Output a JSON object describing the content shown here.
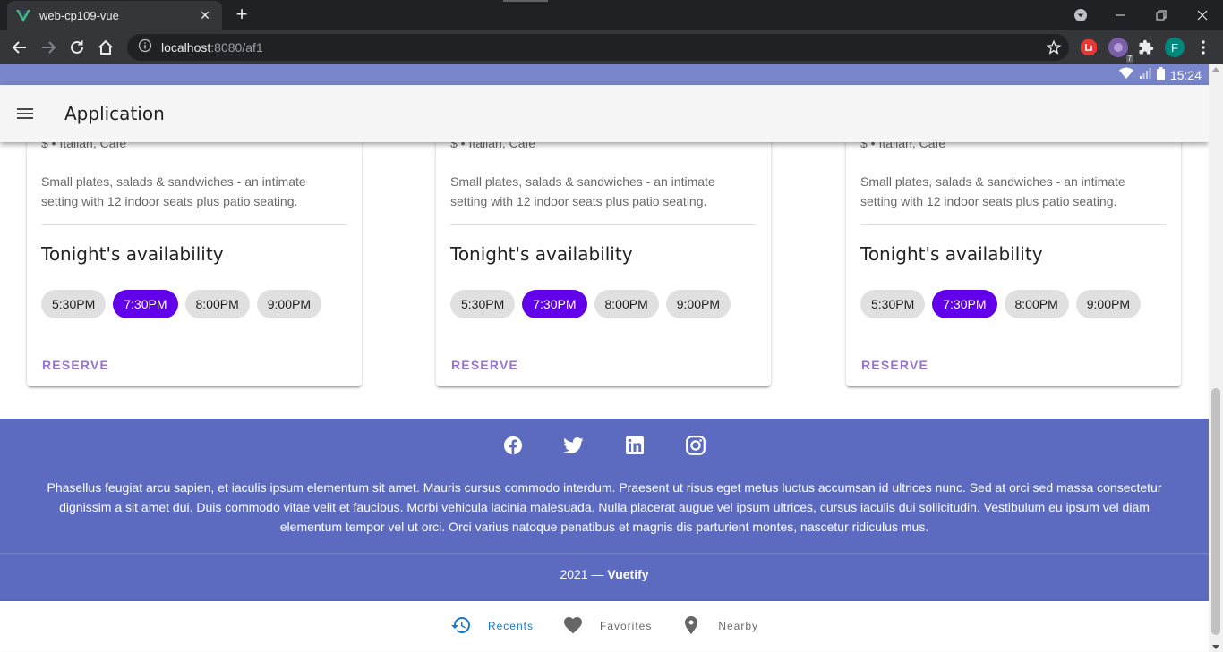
{
  "browser": {
    "tab_title": "web-cp109-vue",
    "url_host": "localhost",
    "url_rest": ":8080/af1",
    "profile_initial": "F",
    "extension_badge": "7"
  },
  "system_bar": {
    "time": "15:24"
  },
  "app_bar": {
    "title": "Application"
  },
  "cards": [
    {
      "meta": "$ • Italian, Cafe",
      "description": "Small plates, salads & sandwiches - an intimate setting with 12 indoor seats plus patio seating.",
      "heading": "Tonight's availability",
      "times": [
        "5:30PM",
        "7:30PM",
        "8:00PM",
        "9:00PM"
      ],
      "selected_time": "7:30PM",
      "action": "RESERVE"
    },
    {
      "meta": "$ • Italian, Cafe",
      "description": "Small plates, salads & sandwiches - an intimate setting with 12 indoor seats plus patio seating.",
      "heading": "Tonight's availability",
      "times": [
        "5:30PM",
        "7:30PM",
        "8:00PM",
        "9:00PM"
      ],
      "selected_time": "7:30PM",
      "action": "RESERVE"
    },
    {
      "meta": "$ • Italian, Cafe",
      "description": "Small plates, salads & sandwiches - an intimate setting with 12 indoor seats plus patio seating.",
      "heading": "Tonight's availability",
      "times": [
        "5:30PM",
        "7:30PM",
        "8:00PM",
        "9:00PM"
      ],
      "selected_time": "7:30PM",
      "action": "RESERVE"
    }
  ],
  "footer": {
    "social_icons": [
      "facebook-icon",
      "twitter-icon",
      "linkedin-icon",
      "instagram-icon"
    ],
    "text": "Phasellus feugiat arcu sapien, et iaculis ipsum elementum sit amet. Mauris cursus commodo interdum. Praesent ut risus eget metus luctus accumsan id ultrices nunc. Sed at orci sed massa consectetur dignissim a sit amet dui. Duis commodo vitae velit et faucibus. Morbi vehicula lacinia malesuada. Nulla placerat augue vel ipsum ultrices, cursus iaculis dui sollicitudin. Vestibulum eu ipsum vel diam elementum tempor vel ut orci. Orci varius natoque penatibus et magnis dis parturient montes, nascetur ridiculus mus.",
    "year": "2021 —",
    "brand": "Vuetify"
  },
  "bottom_nav": {
    "items": [
      {
        "label": "Recents",
        "icon": "history-icon"
      },
      {
        "label": "Favorites",
        "icon": "heart-icon"
      },
      {
        "label": "Nearby",
        "icon": "map-marker-icon"
      }
    ],
    "active": "Recents"
  },
  "colors": {
    "system_bar": "#7986cb",
    "footer": "#5c6bc0",
    "chip_selected": "#6200ea",
    "reserve": "#9575cd",
    "bottom_nav_active": "#1976d2"
  }
}
